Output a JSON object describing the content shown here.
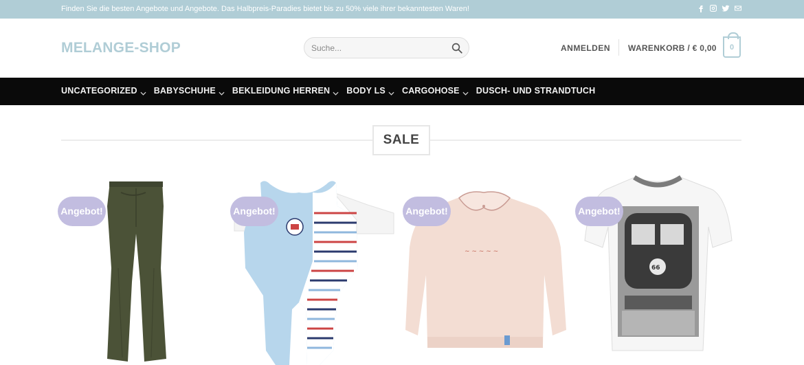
{
  "topbar": {
    "message": "Finden Sie die besten Angebote und Angebote. Das Halbpreis-Paradies bietet bis zu 50% viele ihrer bekanntesten Waren!",
    "social_icons": [
      "facebook-icon",
      "instagram-icon",
      "twitter-icon",
      "email-icon"
    ]
  },
  "header": {
    "logo": "MELANGE-SHOP",
    "search_placeholder": "Suche...",
    "login": "ANMELDEN",
    "cart_label": "WARENKORB / € 0,00",
    "cart_count": "0"
  },
  "nav": {
    "items": [
      {
        "label": "UNCATEGORIZED",
        "has_dropdown": true
      },
      {
        "label": "BABYSCHUHE",
        "has_dropdown": true
      },
      {
        "label": "BEKLEIDUNG HERREN",
        "has_dropdown": true
      },
      {
        "label": "BODY LS",
        "has_dropdown": true
      },
      {
        "label": "CARGOHOSE",
        "has_dropdown": true
      },
      {
        "label": "DUSCH- UND STRANDTUCH",
        "has_dropdown": false
      }
    ]
  },
  "section": {
    "title": "SALE"
  },
  "products": [
    {
      "badge": "Angebot!",
      "image": "olive-pants"
    },
    {
      "badge": "Angebot!",
      "image": "baby-romper"
    },
    {
      "badge": "Angebot!",
      "image": "pink-sweatshirt"
    },
    {
      "badge": "Angebot!",
      "image": "graphic-tshirt"
    }
  ],
  "colors": {
    "accent": "#b0cdd6",
    "nav_bg": "#0a0a0a",
    "badge": "#c2bde0"
  }
}
